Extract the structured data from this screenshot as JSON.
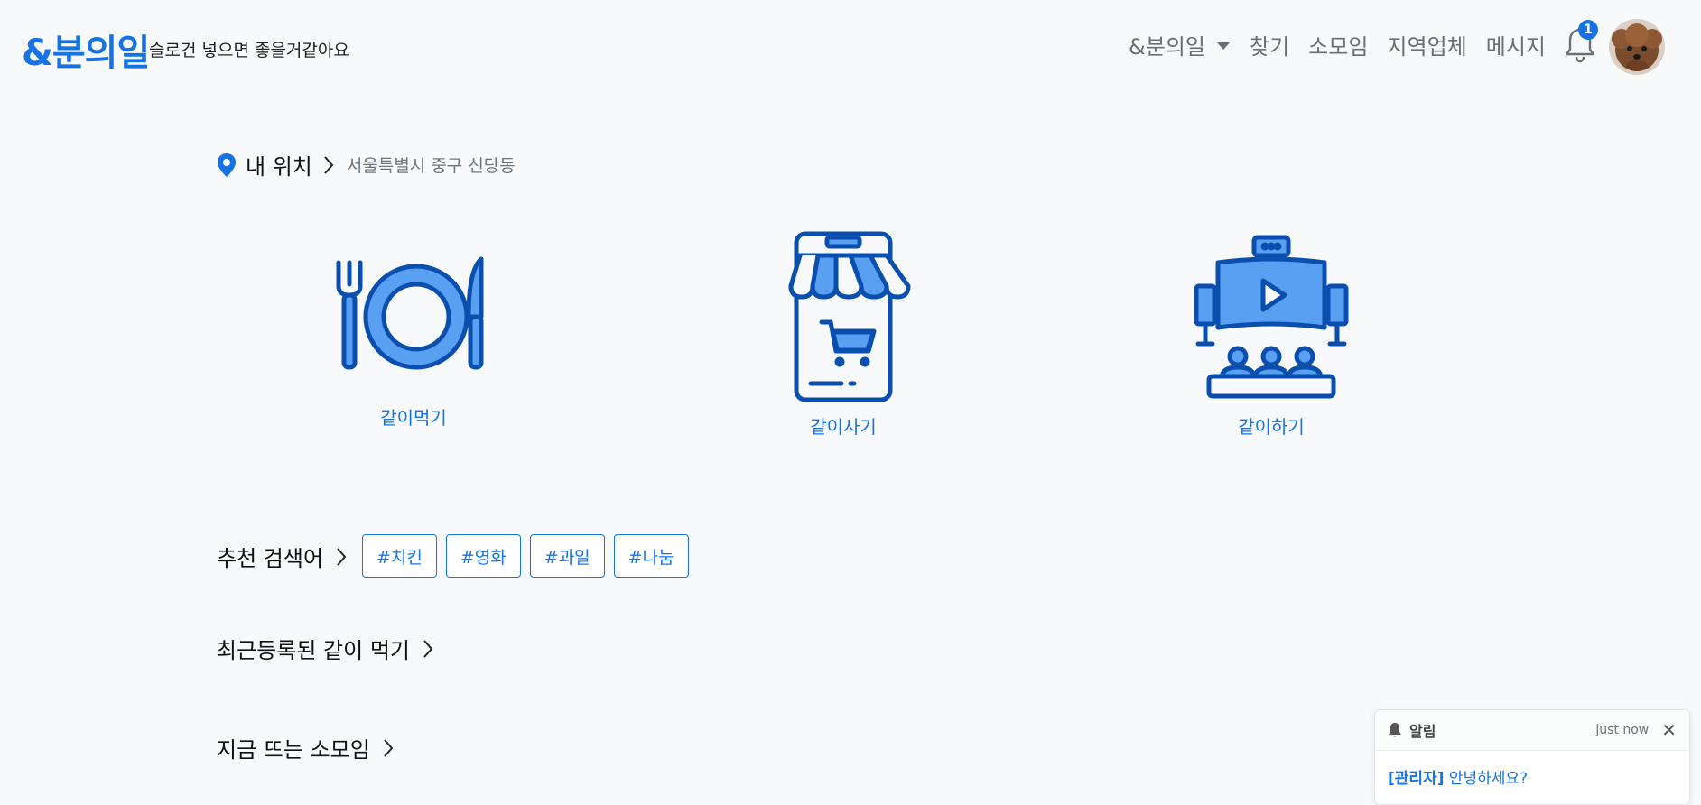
{
  "header": {
    "logo": "&분의일",
    "slogan": "슬로건 넣으면 좋을거같아요",
    "nav": [
      "&분의일",
      "찾기",
      "소모임",
      "지역업체",
      "메시지"
    ],
    "notification_count": "1"
  },
  "location": {
    "label": "내 위치",
    "address": "서울특별시 중구 신당동"
  },
  "categories": [
    {
      "label": "같이먹기",
      "icon": "plate-cutlery-icon"
    },
    {
      "label": "같이사기",
      "icon": "store-cart-icon"
    },
    {
      "label": "같이하기",
      "icon": "cinema-icon"
    }
  ],
  "recommended": {
    "title": "추천 검색어",
    "tags": [
      "#치킨",
      "#영화",
      "#과일",
      "#나눔"
    ]
  },
  "sections": {
    "recent_eat": "최근등록된 같이 먹기",
    "hot_groups": "지금 뜨는 소모임"
  },
  "toast": {
    "title": "알림",
    "time": "just now",
    "sender": "[관리자]",
    "message": " 안녕하세요?"
  },
  "colors": {
    "accent": "#1573e6",
    "icon_fill": "#5aa0f2",
    "icon_stroke": "#0a4fae"
  }
}
